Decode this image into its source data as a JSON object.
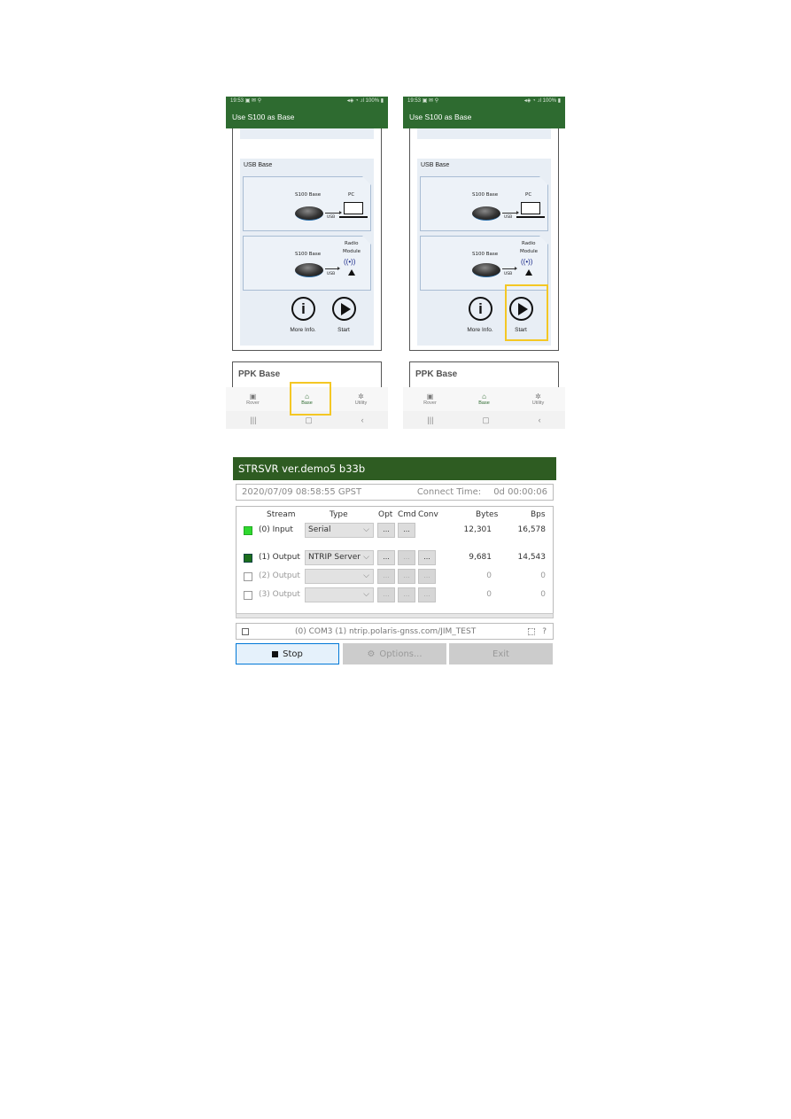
{
  "phones": [
    {
      "id": "left",
      "status": {
        "time": "19:53",
        "left_icons": "▣ ✉ ⚲",
        "right_icons": "◂◈ ◔ .ıl 100% ▮"
      },
      "app_title": "Use S100 as Base",
      "usb_section_title": "USB Base",
      "diagram1": {
        "device": "S100 Base",
        "link": "USB",
        "target": "PC"
      },
      "diagram2": {
        "device": "S100 Base",
        "link": "USB",
        "target": "Radio Module",
        "target_line1": "Radio",
        "target_line2": "Module",
        "radio_glyph": "((•))"
      },
      "more_info_label": "More Info.",
      "start_label": "Start",
      "ppk_title": "PPK Base",
      "nav": [
        {
          "label": "Rover",
          "icon": "car-icon",
          "glyph": "▣"
        },
        {
          "label": "Base",
          "icon": "home-icon",
          "glyph": "⌂"
        },
        {
          "label": "Utility",
          "icon": "gear-icon",
          "glyph": "✲"
        }
      ],
      "sysnav": {
        "recents": "|||",
        "home": "▢",
        "back": "‹"
      },
      "highlight": "Base tab"
    },
    {
      "id": "right",
      "status": {
        "time": "19:53",
        "left_icons": "▣ ✉ ⚲",
        "right_icons": "◂◈ ◔ .ıl 100% ▮"
      },
      "app_title": "Use S100 as Base",
      "usb_section_title": "USB Base",
      "diagram1": {
        "device": "S100 Base",
        "link": "USB",
        "target": "PC"
      },
      "diagram2": {
        "device": "S100 Base",
        "link": "USB",
        "target": "Radio Module",
        "target_line1": "Radio",
        "target_line2": "Module",
        "radio_glyph": "((•))"
      },
      "more_info_label": "More Info.",
      "start_label": "Start",
      "ppk_title": "PPK Base",
      "nav": [
        {
          "label": "Rover",
          "icon": "car-icon",
          "glyph": "▣"
        },
        {
          "label": "Base",
          "icon": "home-icon",
          "glyph": "⌂"
        },
        {
          "label": "Utility",
          "icon": "gear-icon",
          "glyph": "✲"
        }
      ],
      "sysnav": {
        "recents": "|||",
        "home": "▢",
        "back": "‹"
      },
      "highlight": "Start button"
    }
  ],
  "strsvr": {
    "title": "STRSVR ver.demo5 b33b",
    "datetime": "2020/07/09 08:58:55 GPST",
    "connect_label": "Connect Time:",
    "connect_time": "0d 00:00:06",
    "headers": {
      "stream": "Stream",
      "type": "Type",
      "opt": "Opt",
      "cmd": "Cmd",
      "conv": "Conv",
      "bytes": "Bytes",
      "bps": "Bps"
    },
    "dots": "...",
    "rows": [
      {
        "label": "(0) Input",
        "checked": true,
        "type": "Serial",
        "bytes": "12,301",
        "bps": "16,578"
      },
      {
        "label": "(1) Output",
        "checked": true,
        "type": "NTRIP Server",
        "bytes": "9,681",
        "bps": "14,543"
      },
      {
        "label": "(2) Output",
        "checked": false,
        "type": "",
        "bytes": "0",
        "bps": "0"
      },
      {
        "label": "(3) Output",
        "checked": false,
        "type": "",
        "bytes": "0",
        "bps": "0"
      }
    ],
    "message": "(0) COM3 (1) ntrip.polaris-gnss.com/JIM_TEST",
    "help_glyph": "?",
    "buttons": {
      "stop": "Stop",
      "options": "Options...",
      "exit": "Exit"
    },
    "colors": {
      "titlebar": "#2e5c22",
      "input_active": "#2fd82f",
      "output_active": "#1c6e1c"
    }
  }
}
